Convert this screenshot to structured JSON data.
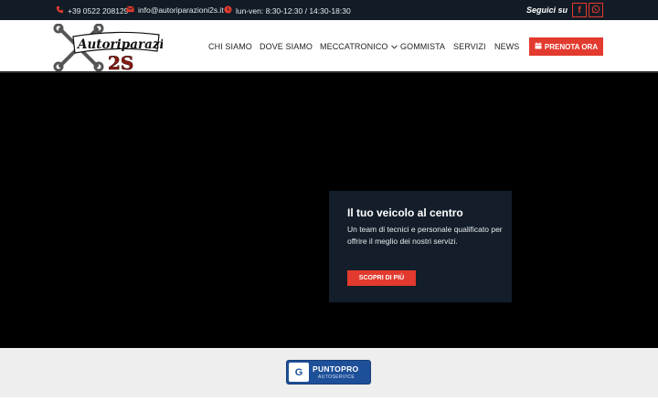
{
  "topbar": {
    "phone": "+39 0522 208129",
    "email": "info@autoriparazioni2s.it",
    "hours": "lun-ven: 8:30-12:30 / 14:30-18:30",
    "follow_label": "Seguici su",
    "icons": [
      "phone-icon",
      "mail-icon",
      "clock-icon",
      "facebook-icon",
      "whatsapp-icon"
    ]
  },
  "header": {
    "logo_text_top": "Autoriparazioni",
    "logo_text_bottom": "2S",
    "nav": {
      "chi_siamo": "CHI SIAMO",
      "dove_siamo": "DOVE SIAMO",
      "meccatronico": "MECCATRONICO",
      "gommista": "GOMMISTA",
      "servizi": "SERVIZI",
      "news": "NEWS"
    },
    "cta_label": "PRENOTA ORA"
  },
  "hero": {
    "title": "Il tuo veicolo al centro",
    "text": "Un team di tecnici e personale qualificato per offrire il meglio dei nostri servizi.",
    "button": "SCOPRI DI PIÙ"
  },
  "partner": {
    "brand_top": "PUNTOPRO",
    "brand_bottom": "AUTOSERVICE",
    "mark": "G"
  },
  "colors": {
    "accent": "#e23a2e",
    "topbar_bg": "#121c26",
    "card_bg": "#131e2a"
  }
}
